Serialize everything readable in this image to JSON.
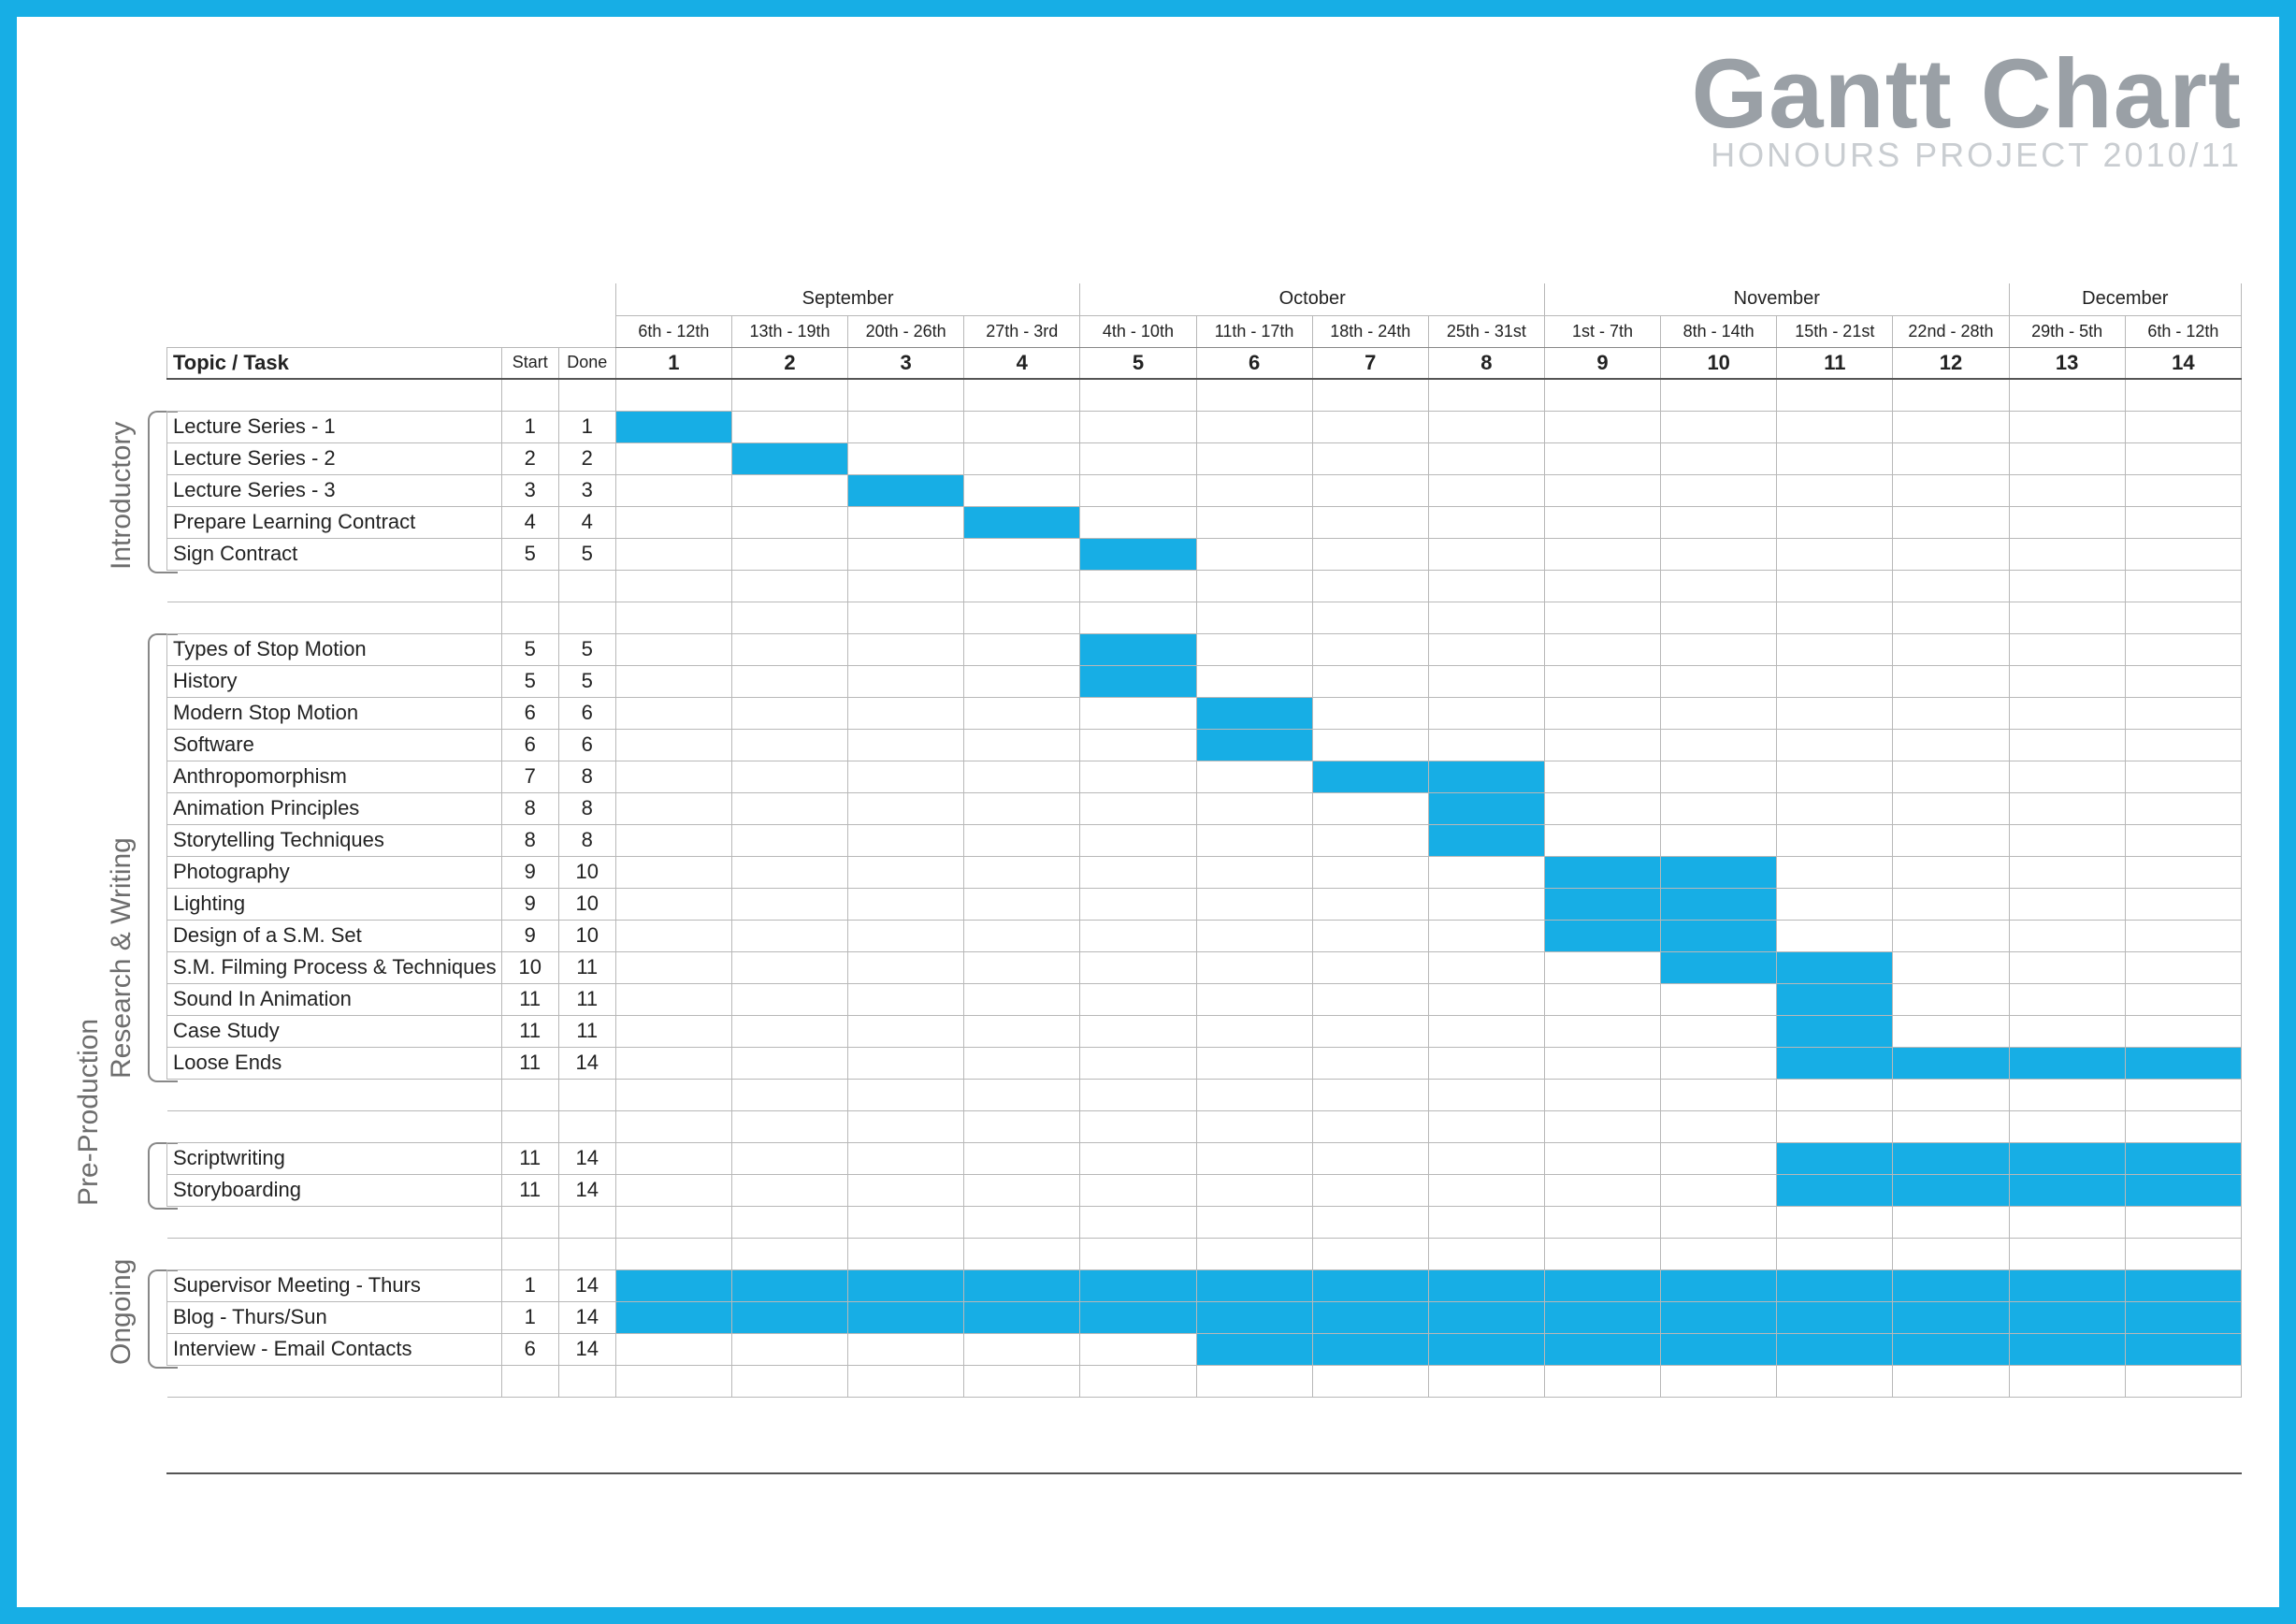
{
  "title": "Gantt Chart",
  "subtitle": "HONOURS PROJECT 2010/11",
  "header_task": "Topic / Task",
  "header_start": "Start",
  "header_done": "Done",
  "months": [
    {
      "label": "September",
      "span": 4
    },
    {
      "label": "October",
      "span": 4
    },
    {
      "label": "November",
      "span": 4
    },
    {
      "label": "December",
      "span": 2
    }
  ],
  "date_ranges": [
    "6th - 12th",
    "13th - 19th",
    "20th - 26th",
    "27th - 3rd",
    "4th - 10th",
    "11th - 17th",
    "18th - 24th",
    "25th - 31st",
    "1st - 7th",
    "8th - 14th",
    "15th - 21st",
    "22nd - 28th",
    "29th - 5th",
    "6th - 12th"
  ],
  "week_numbers": [
    "1",
    "2",
    "3",
    "4",
    "5",
    "6",
    "7",
    "8",
    "9",
    "10",
    "11",
    "12",
    "13",
    "14"
  ],
  "categories": [
    {
      "label": "Introductory"
    },
    {
      "label": "Research & Writing"
    },
    {
      "label": "Pre-Production"
    },
    {
      "label": "Ongoing"
    }
  ],
  "chart_data": {
    "type": "gantt",
    "x_units": "week",
    "weeks": 14,
    "groups": [
      {
        "name": "Introductory",
        "tasks": [
          {
            "label": "Lecture Series - 1",
            "start": 1,
            "done": 1,
            "bar_from": 1,
            "bar_to": 1
          },
          {
            "label": "Lecture Series - 2",
            "start": 2,
            "done": 2,
            "bar_from": 2,
            "bar_to": 2
          },
          {
            "label": "Lecture Series - 3",
            "start": 3,
            "done": 3,
            "bar_from": 3,
            "bar_to": 3
          },
          {
            "label": "Prepare Learning Contract",
            "start": 4,
            "done": 4,
            "bar_from": 4,
            "bar_to": 4
          },
          {
            "label": "Sign Contract",
            "start": 5,
            "done": 5,
            "bar_from": 5,
            "bar_to": 5
          }
        ]
      },
      {
        "name": "Research & Writing",
        "tasks": [
          {
            "label": "Types of Stop Motion",
            "start": 5,
            "done": 5,
            "bar_from": 5,
            "bar_to": 5
          },
          {
            "label": "History",
            "start": 5,
            "done": 5,
            "bar_from": 5,
            "bar_to": 5
          },
          {
            "label": "Modern Stop Motion",
            "start": 6,
            "done": 6,
            "bar_from": 6,
            "bar_to": 6
          },
          {
            "label": "Software",
            "start": 6,
            "done": 6,
            "bar_from": 6,
            "bar_to": 6
          },
          {
            "label": "Anthropomorphism",
            "start": 7,
            "done": 8,
            "bar_from": 7,
            "bar_to": 8
          },
          {
            "label": "Animation Principles",
            "start": 8,
            "done": 8,
            "bar_from": 8,
            "bar_to": 8
          },
          {
            "label": "Storytelling Techniques",
            "start": 8,
            "done": 8,
            "bar_from": 8,
            "bar_to": 8
          },
          {
            "label": "Photography",
            "start": 9,
            "done": 10,
            "bar_from": 9,
            "bar_to": 10
          },
          {
            "label": "Lighting",
            "start": 9,
            "done": 10,
            "bar_from": 9,
            "bar_to": 10
          },
          {
            "label": "Design of a S.M. Set",
            "start": 9,
            "done": 10,
            "bar_from": 9,
            "bar_to": 10
          },
          {
            "label": "S.M. Filming Process & Techniques",
            "start": 10,
            "done": 11,
            "bar_from": 10,
            "bar_to": 11
          },
          {
            "label": "Sound In Animation",
            "start": 11,
            "done": 11,
            "bar_from": 11,
            "bar_to": 11
          },
          {
            "label": "Case Study",
            "start": 11,
            "done": 11,
            "bar_from": 11,
            "bar_to": 11
          },
          {
            "label": "Loose Ends",
            "start": 11,
            "done": 14,
            "bar_from": 11,
            "bar_to": 14
          }
        ]
      },
      {
        "name": "Pre-Production",
        "tasks": [
          {
            "label": "Scriptwriting",
            "start": 11,
            "done": 14,
            "bar_from": 11,
            "bar_to": 14
          },
          {
            "label": "Storyboarding",
            "start": 11,
            "done": 14,
            "bar_from": 11,
            "bar_to": 14
          }
        ]
      },
      {
        "name": "Ongoing",
        "tasks": [
          {
            "label": "Supervisor Meeting - Thurs",
            "start": 1,
            "done": 14,
            "bar_from": 1,
            "bar_to": 14
          },
          {
            "label": "Blog - Thurs/Sun",
            "start": 1,
            "done": 14,
            "bar_from": 1,
            "bar_to": 14
          },
          {
            "label": "Interview - Email Contacts",
            "start": 6,
            "done": 14,
            "bar_from": 6,
            "bar_to": 14
          }
        ]
      }
    ]
  }
}
